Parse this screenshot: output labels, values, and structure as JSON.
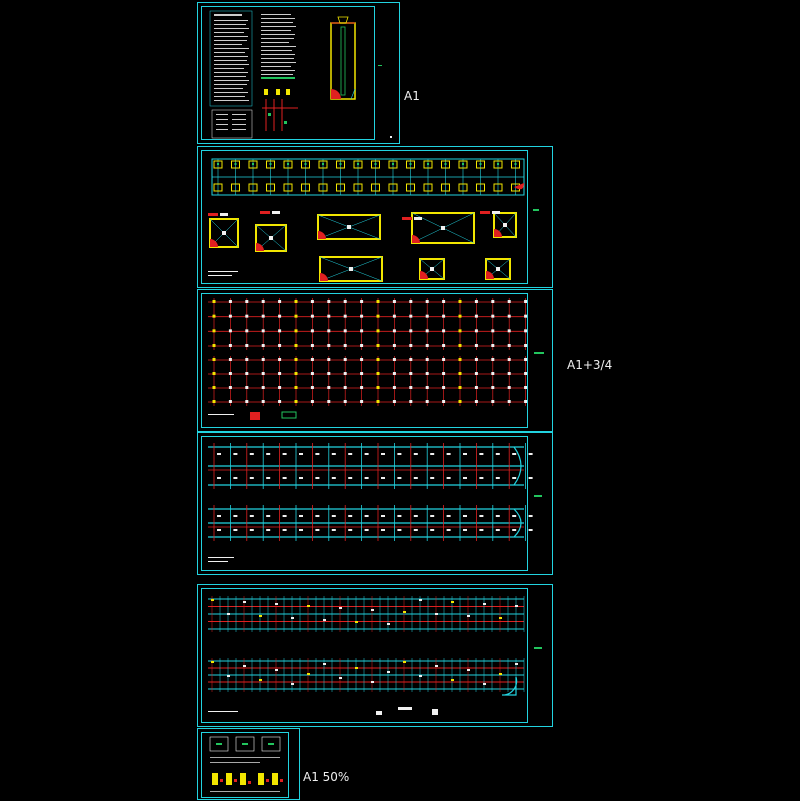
{
  "sheets": [
    {
      "id": "sheet-1",
      "size_label": "A1"
    },
    {
      "id": "sheet-2",
      "size_label": ""
    },
    {
      "id": "sheet-3",
      "size_label": "A1+3/4"
    },
    {
      "id": "sheet-4",
      "size_label": ""
    },
    {
      "id": "sheet-5",
      "size_label": ""
    },
    {
      "id": "sheet-6",
      "size_label": "A1 50%"
    }
  ],
  "colors": {
    "frame": "#22d3e0",
    "footing": "#f2e600",
    "grid_red": "#e02020",
    "grid_cyan": "#22d3e0",
    "text_white": "#f0f0f0",
    "accent_green": "#22c55e"
  }
}
